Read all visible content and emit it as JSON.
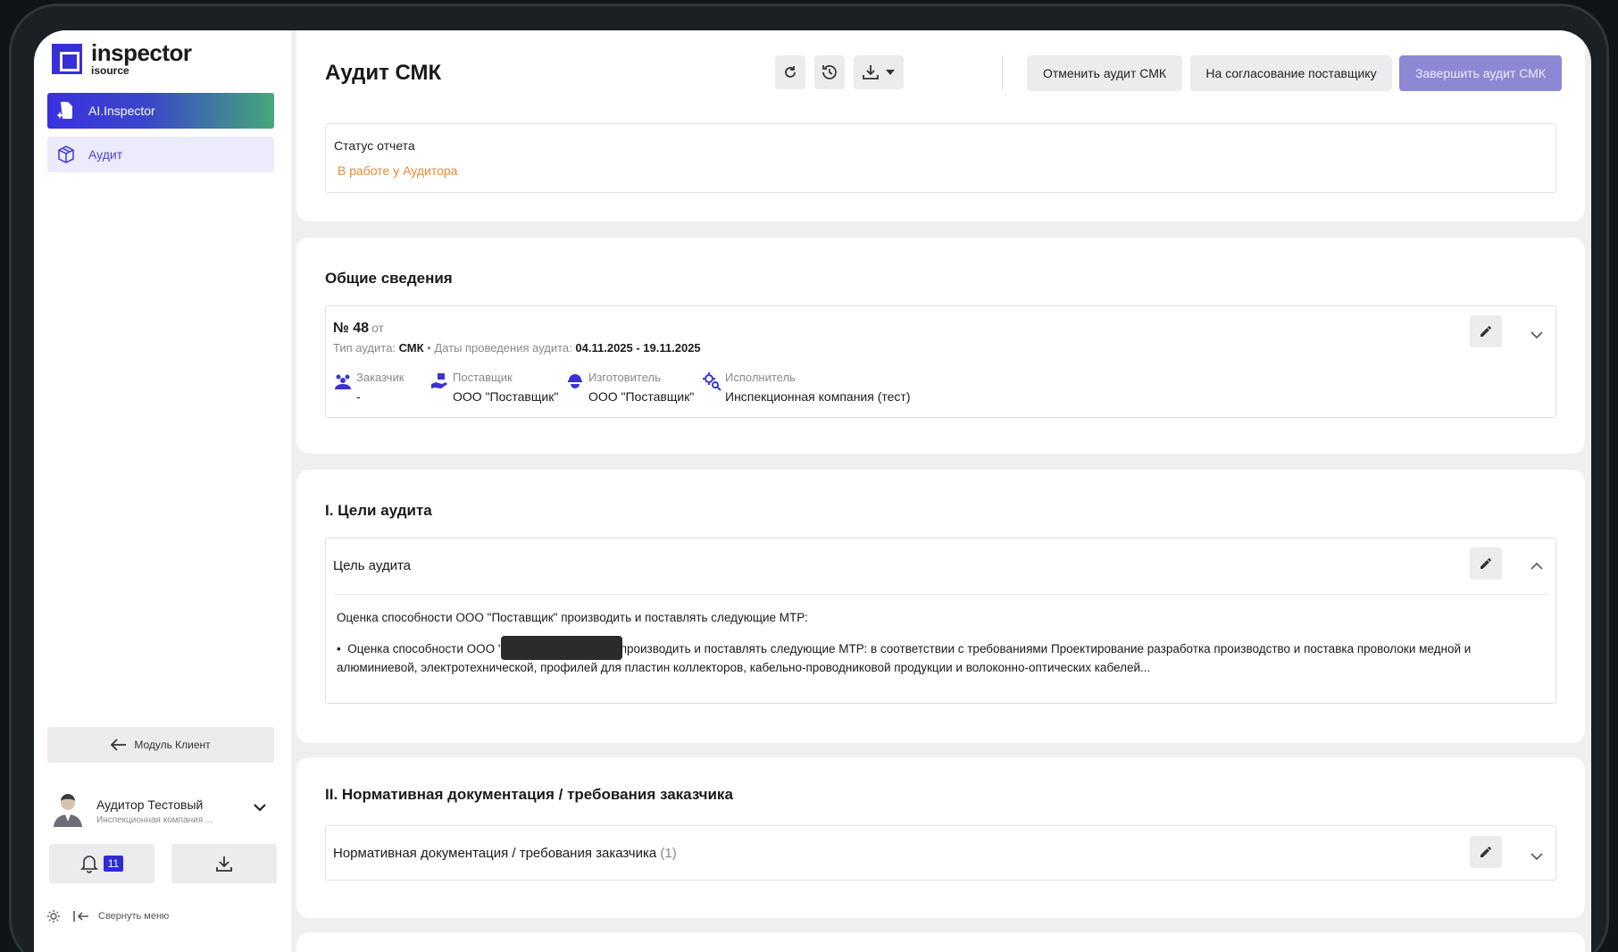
{
  "sidebar": {
    "logo_name": "inspector",
    "logo_sub": "isource",
    "nav": [
      {
        "label": "AI.Inspector",
        "icon": "ai-inspector-icon"
      },
      {
        "label": "Аудит",
        "icon": "cube-icon"
      }
    ],
    "module_button": "Модуль Клиент",
    "user": {
      "name": "Аудитор Тестовый",
      "org": "Инспекционная компания ..."
    },
    "notifications_count": "11",
    "collapse_label": "Свернуть меню"
  },
  "header": {
    "title": "Аудит СМК",
    "buttons": {
      "cancel": "Отменить аудит СМК",
      "approve": "На согласование поставщику",
      "finish": "Завершить аудит СМК"
    }
  },
  "status": {
    "label": "Статус отчета",
    "value": "В работе у Аудитора"
  },
  "general": {
    "title": "Общие сведения",
    "number": "№ 48",
    "from": "от",
    "type_label": "Тип аудита:",
    "type_value": "СМК",
    "separator": "•",
    "dates_label": "Даты проведения аудита:",
    "dates_value": "04.11.2025 - 19.11.2025",
    "parties": [
      {
        "label": "Заказчик",
        "value": "-"
      },
      {
        "label": "Поставщик",
        "value": "ООО \"Поставщик\""
      },
      {
        "label": "Изготовитель",
        "value": "ООО \"Поставщик\""
      },
      {
        "label": "Исполнитель",
        "value": "Инспекционная компания (тест)"
      }
    ]
  },
  "goals": {
    "title": "I. Цели аудита",
    "heading": "Цель аудита",
    "intro": "Оценка способности ООО \"Поставщик\" производить и поставлять следующие МТР:",
    "bullet_start": "Оценка способности ООО \"",
    "bullet_rest": "производить и поставлять следующие МТР: в соответствии с требованиями Проектирование разработка производство и поставка проволоки медной и алюминиевой, электротехнической, профилей для пластин коллекторов, кабельно-проводниковой продукции и волоконно-оптических кабелей..."
  },
  "norms": {
    "title": "II. Нормативная документация / требования заказчика",
    "heading": "Нормативная документация / требования заказчика",
    "count": "(1)"
  },
  "colors": {
    "accent": "#3730d9",
    "status_orange": "#e98a2f",
    "primary_disabled": "#8c88d4"
  }
}
